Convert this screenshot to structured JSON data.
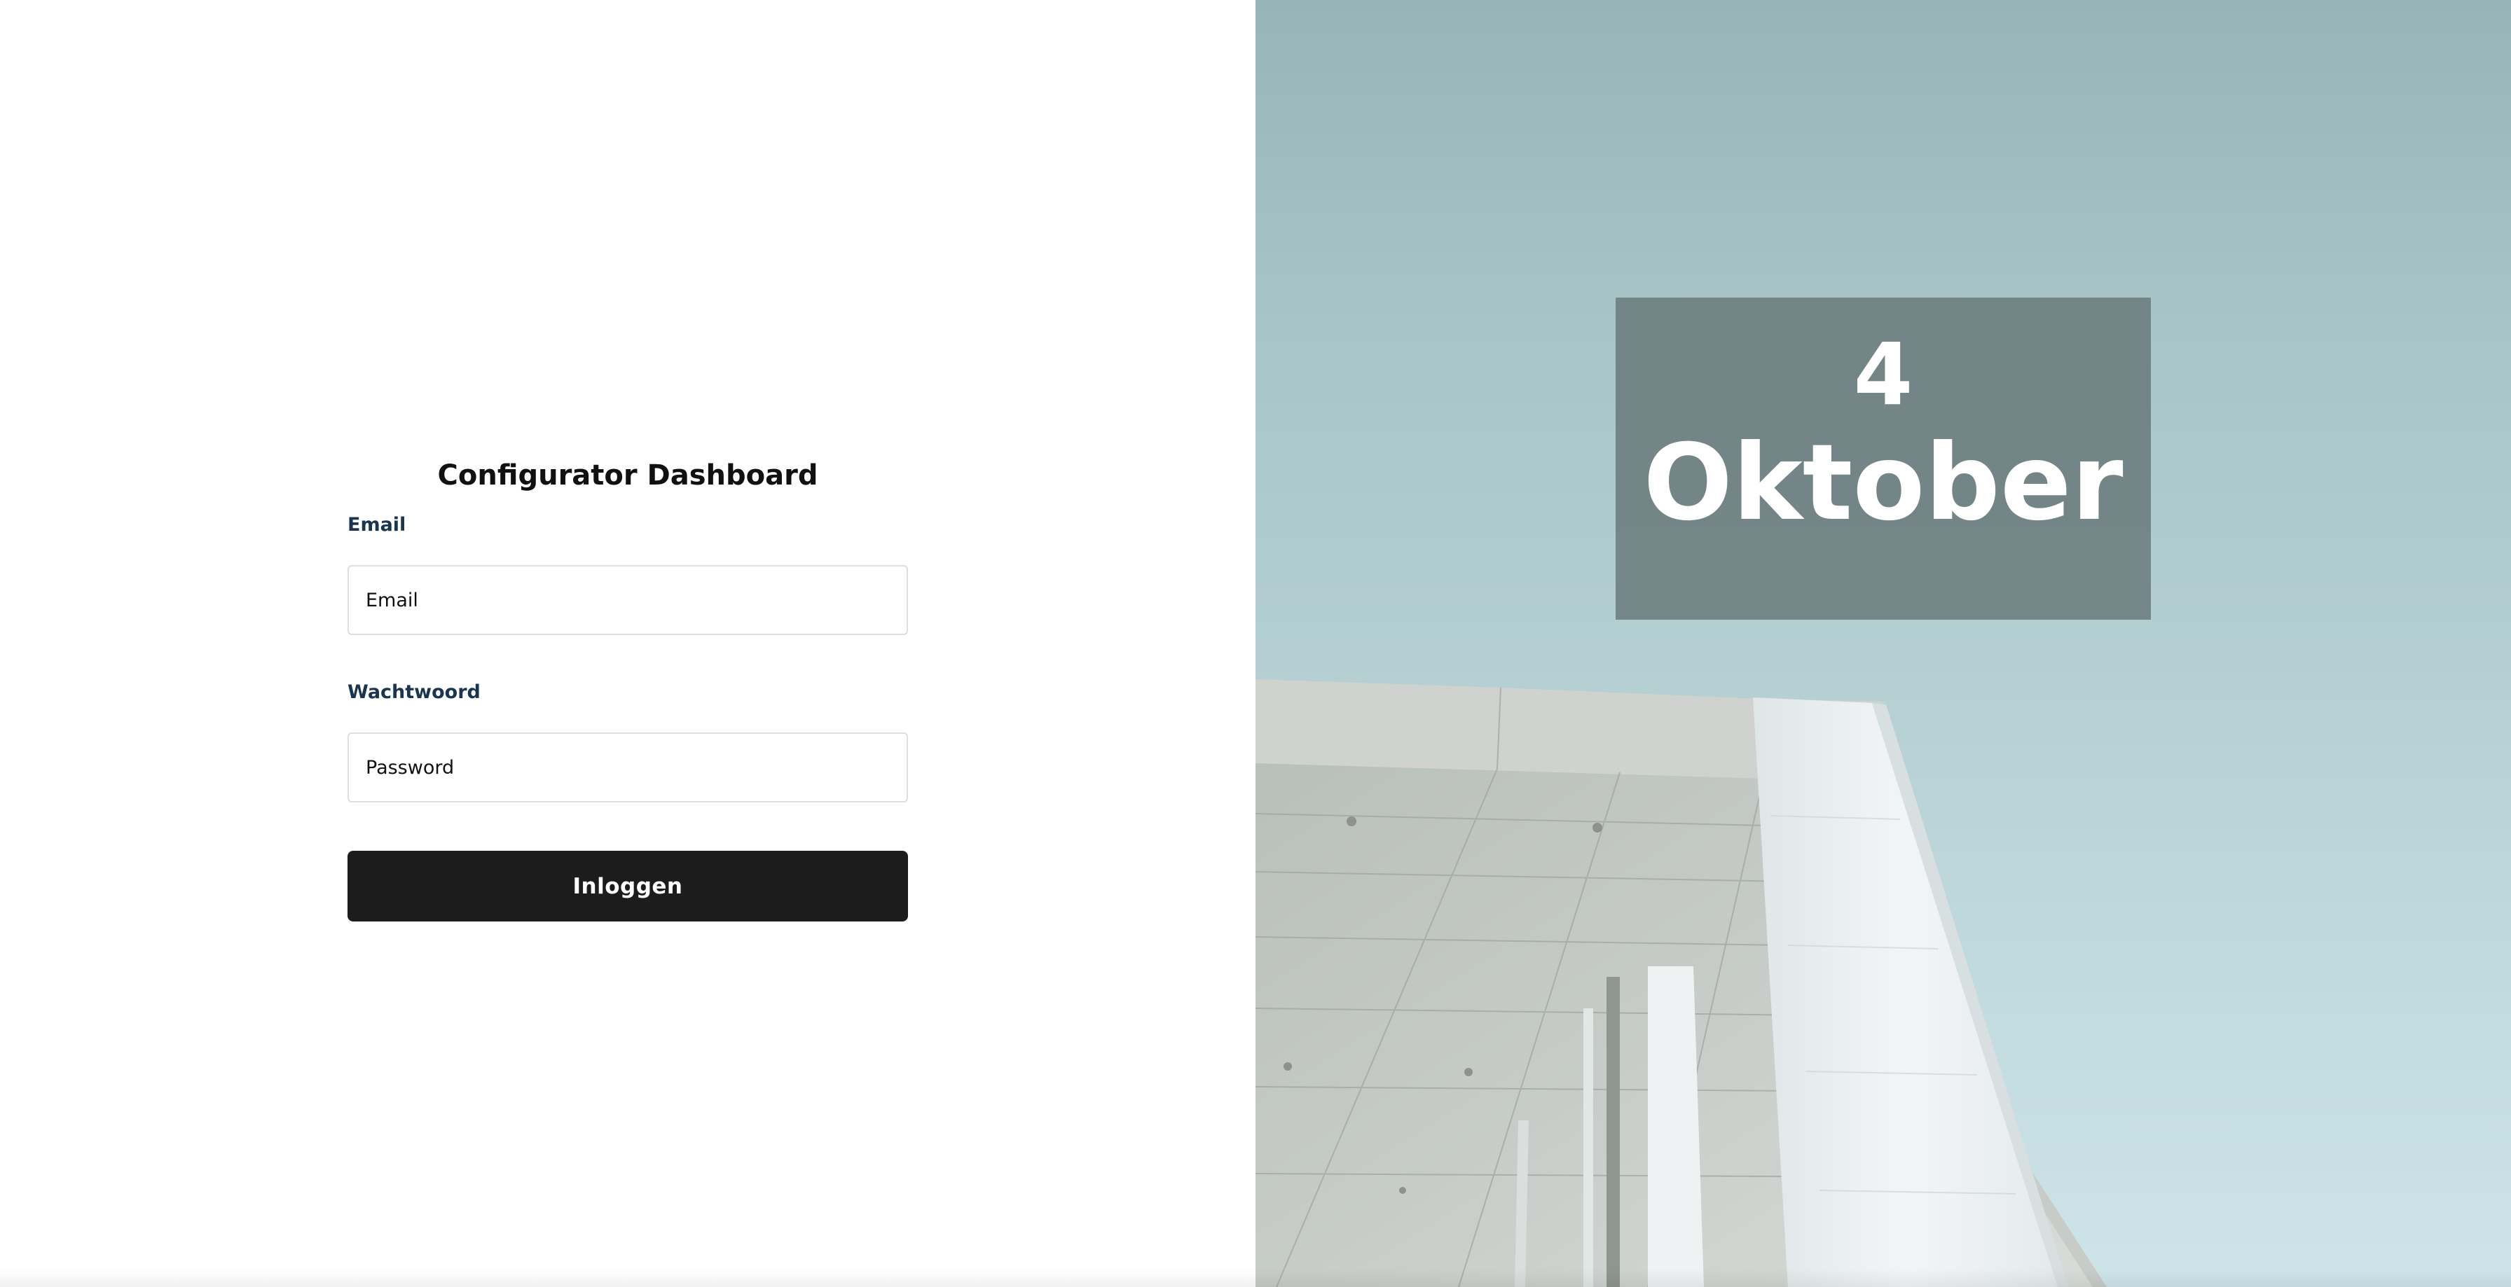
{
  "login": {
    "title": "Configurator Dashboard",
    "email_label": "Email",
    "email_placeholder": "Email",
    "password_label": "Wachtwoord",
    "password_placeholder": "Password",
    "submit_label": "Inloggen"
  },
  "date_banner": {
    "day": "4",
    "month": "Oktober"
  },
  "colors": {
    "label_text": "#1a3550",
    "button_bg": "#1c1c1c",
    "date_box_bg": "#708082",
    "sky": "#a7c4c6"
  }
}
